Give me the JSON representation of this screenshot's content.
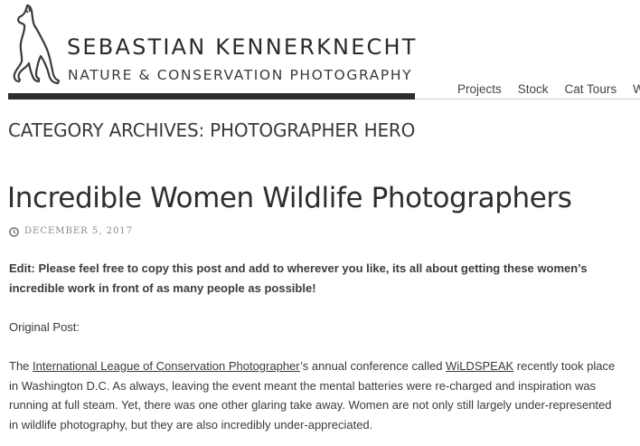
{
  "site": {
    "title": "SEBASTIAN KENNERKNECHT",
    "tagline": "NATURE & CONSERVATION PHOTOGRAPHY",
    "logo_icon": "cat-silhouette-icon"
  },
  "nav": {
    "items": [
      {
        "label": "Projects"
      },
      {
        "label": "Stock"
      },
      {
        "label": "Cat Tours"
      },
      {
        "label": "Wo"
      }
    ]
  },
  "archive": {
    "title": "CATEGORY ARCHIVES: PHOTOGRAPHER HERO"
  },
  "post": {
    "title": "Incredible Women Wildlife Photographers",
    "date": "DECEMBER 5, 2017",
    "date_icon": "clock-icon",
    "edit_note": "Edit: Please feel free to copy this post and add to wherever you like, its all about getting these women’s incredible work in front of as many people as possible!",
    "original_label": "Original Post:",
    "body_prefix": "The ",
    "link_ilcp": "International League of Conservation Photographer",
    "body_mid": "’s annual conference called ",
    "link_wildspeak": "WiLDSPEAK",
    "body_rest": " recently took place in Washington D.C. As always, leaving the event meant the mental batteries were re-charged and inspiration was running at full steam. Yet, there was one other glaring take away. Women are not only still largely under-represented in wildlife photography, but they are also incredibly under-appreciated."
  },
  "colors": {
    "text": "#3a3a3a",
    "header_bar": "#2d2d2d",
    "meta": "#8a8a8a"
  }
}
